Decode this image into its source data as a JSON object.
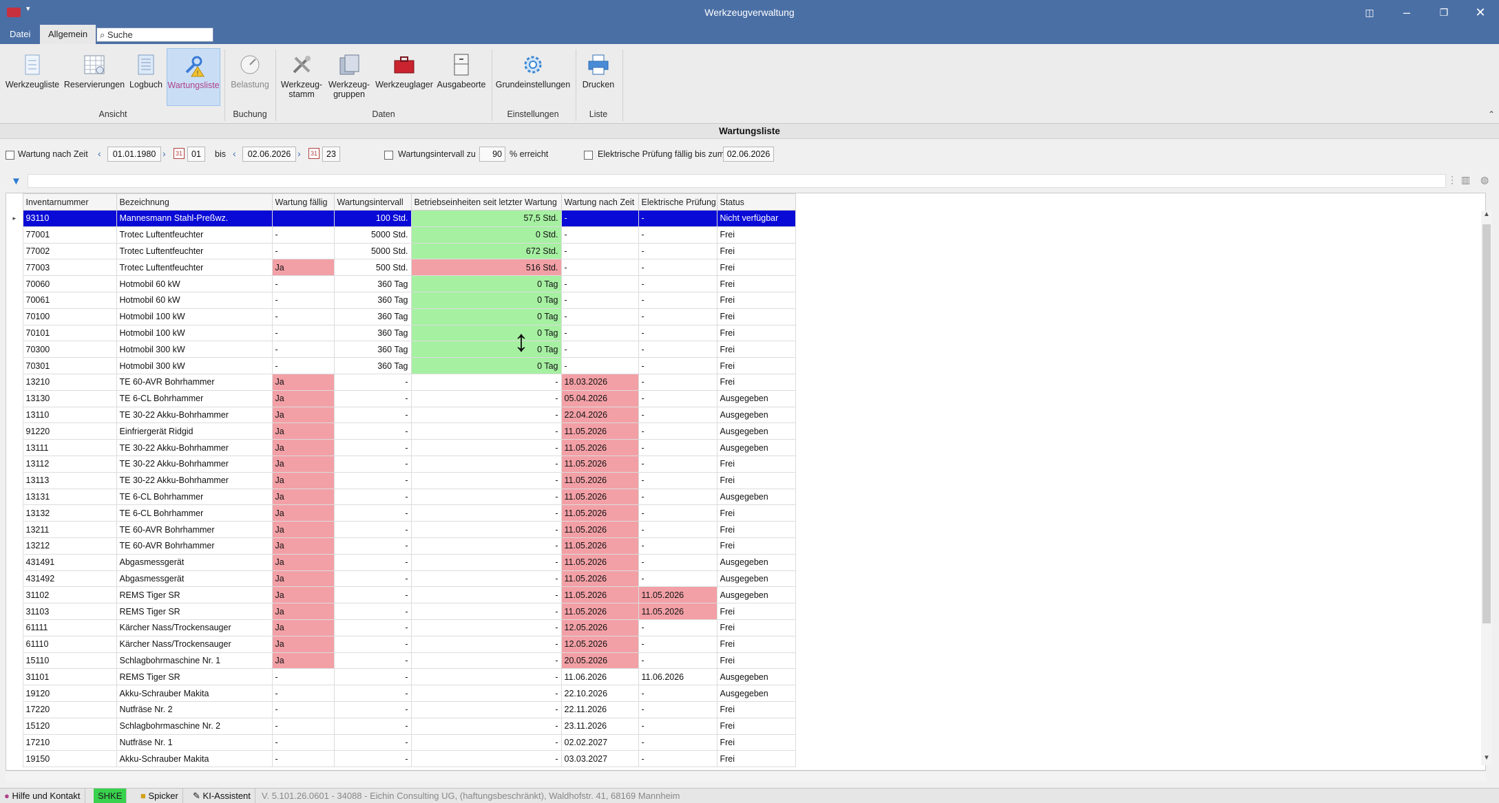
{
  "window": {
    "title": "Werkzeugverwaltung"
  },
  "menu": {
    "tab_datei": "Datei",
    "tab_allgemein": "Allgemein",
    "search_placeholder": "Suche"
  },
  "ribbon": {
    "buttons": [
      {
        "label": "Werkzeugliste"
      },
      {
        "label": "Reservierungen"
      },
      {
        "label": "Logbuch"
      },
      {
        "label": "Wartungsliste"
      },
      {
        "label": "Belastung"
      },
      {
        "label": "Werkzeug-\nstamm"
      },
      {
        "label": "Werkzeug-\ngruppen"
      },
      {
        "label": "Werkzeuglager"
      },
      {
        "label": "Ausgabeorte"
      },
      {
        "label": "Grundeinstellungen"
      },
      {
        "label": "Drucken"
      }
    ],
    "groups": [
      "Ansicht",
      "Buchung",
      "Daten",
      "Einstellungen",
      "Liste"
    ]
  },
  "section_title": "Wartungsliste",
  "filters": {
    "wartung_nach_zeit_label": "Wartung nach Zeit",
    "date_from": "01.01.1980",
    "day_from": "01",
    "bis_label": "bis",
    "date_to": "02.06.2026",
    "day_to": "23",
    "intervall_label": "Wartungsintervall zu",
    "intervall_value": "90",
    "intervall_suffix": "% erreicht",
    "elektrisch_label": "Elektrische Prüfung fällig bis zum",
    "elektrisch_date": "02.06.2026"
  },
  "table": {
    "columns": [
      "Inventarnummer",
      "Bezeichnung",
      "Wartung fällig",
      "Wartungsintervall",
      "Betriebseinheiten seit letzter Wartung",
      "Wartung nach Zeit",
      "Elektrische Prüfung",
      "Status"
    ],
    "rows": [
      [
        "93110",
        "Mannesmann Stahl-Preßwz.",
        "",
        "100 Std.",
        "57,5 Std.",
        "-",
        "-",
        "Nicht verfügbar"
      ],
      [
        "77001",
        "Trotec Luftentfeuchter",
        "-",
        "5000 Std.",
        "0 Std.",
        "-",
        "-",
        "Frei"
      ],
      [
        "77002",
        "Trotec Luftentfeuchter",
        "-",
        "5000 Std.",
        "672 Std.",
        "-",
        "-",
        "Frei"
      ],
      [
        "77003",
        "Trotec Luftentfeuchter",
        "Ja",
        "500 Std.",
        "516 Std.",
        "-",
        "-",
        "Frei"
      ],
      [
        "70060",
        "Hotmobil 60 kW",
        "-",
        "360 Tag",
        "0 Tag",
        "-",
        "-",
        "Frei"
      ],
      [
        "70061",
        "Hotmobil 60 kW",
        "-",
        "360 Tag",
        "0 Tag",
        "-",
        "-",
        "Frei"
      ],
      [
        "70100",
        "Hotmobil 100 kW",
        "-",
        "360 Tag",
        "0 Tag",
        "-",
        "-",
        "Frei"
      ],
      [
        "70101",
        "Hotmobil 100 kW",
        "-",
        "360 Tag",
        "0 Tag",
        "-",
        "-",
        "Frei"
      ],
      [
        "70300",
        "Hotmobil 300 kW",
        "-",
        "360 Tag",
        "0 Tag",
        "-",
        "-",
        "Frei"
      ],
      [
        "70301",
        "Hotmobil 300 kW",
        "-",
        "360 Tag",
        "0 Tag",
        "-",
        "-",
        "Frei"
      ],
      [
        "13210",
        "TE 60-AVR Bohrhammer",
        "Ja",
        "-",
        "-",
        "18.03.2026",
        "-",
        "Frei"
      ],
      [
        "13130",
        "TE 6-CL Bohrhammer",
        "Ja",
        "-",
        "-",
        "05.04.2026",
        "-",
        "Ausgegeben"
      ],
      [
        "13110",
        "TE 30-22 Akku-Bohrhammer",
        "Ja",
        "-",
        "-",
        "22.04.2026",
        "-",
        "Ausgegeben"
      ],
      [
        "91220",
        "Einfriergerät Ridgid",
        "Ja",
        "-",
        "-",
        "11.05.2026",
        "-",
        "Ausgegeben"
      ],
      [
        "13111",
        "TE 30-22 Akku-Bohrhammer",
        "Ja",
        "-",
        "-",
        "11.05.2026",
        "-",
        "Ausgegeben"
      ],
      [
        "13112",
        "TE 30-22 Akku-Bohrhammer",
        "Ja",
        "-",
        "-",
        "11.05.2026",
        "-",
        "Frei"
      ],
      [
        "13113",
        "TE 30-22 Akku-Bohrhammer",
        "Ja",
        "-",
        "-",
        "11.05.2026",
        "-",
        "Frei"
      ],
      [
        "13131",
        "TE 6-CL Bohrhammer",
        "Ja",
        "-",
        "-",
        "11.05.2026",
        "-",
        "Ausgegeben"
      ],
      [
        "13132",
        "TE 6-CL Bohrhammer",
        "Ja",
        "-",
        "-",
        "11.05.2026",
        "-",
        "Frei"
      ],
      [
        "13211",
        "TE 60-AVR Bohrhammer",
        "Ja",
        "-",
        "-",
        "11.05.2026",
        "-",
        "Frei"
      ],
      [
        "13212",
        "TE 60-AVR Bohrhammer",
        "Ja",
        "-",
        "-",
        "11.05.2026",
        "-",
        "Frei"
      ],
      [
        "431491",
        "Abgasmessgerät",
        "Ja",
        "-",
        "-",
        "11.05.2026",
        "-",
        "Ausgegeben"
      ],
      [
        "431492",
        "Abgasmessgerät",
        "Ja",
        "-",
        "-",
        "11.05.2026",
        "-",
        "Ausgegeben"
      ],
      [
        "31102",
        "REMS Tiger SR",
        "Ja",
        "-",
        "-",
        "11.05.2026",
        "11.05.2026",
        "Ausgegeben"
      ],
      [
        "31103",
        "REMS Tiger SR",
        "Ja",
        "-",
        "-",
        "11.05.2026",
        "11.05.2026",
        "Frei"
      ],
      [
        "61111",
        "Kärcher Nass/Trockensauger",
        "Ja",
        "-",
        "-",
        "12.05.2026",
        "-",
        "Frei"
      ],
      [
        "61110",
        "Kärcher Nass/Trockensauger",
        "Ja",
        "-",
        "-",
        "12.05.2026",
        "-",
        "Frei"
      ],
      [
        "15110",
        "Schlagbohrmaschine Nr. 1",
        "Ja",
        "-",
        "-",
        "20.05.2026",
        "-",
        "Frei"
      ],
      [
        "31101",
        "REMS Tiger SR",
        "-",
        "-",
        "-",
        "11.06.2026",
        "11.06.2026",
        "Ausgegeben"
      ],
      [
        "19120",
        "Akku-Schrauber Makita",
        "-",
        "-",
        "-",
        "22.10.2026",
        "-",
        "Ausgegeben"
      ],
      [
        "17220",
        "Nutfräse Nr. 2",
        "-",
        "-",
        "-",
        "22.11.2026",
        "-",
        "Frei"
      ],
      [
        "15120",
        "Schlagbohrmaschine Nr. 2",
        "-",
        "-",
        "-",
        "23.11.2026",
        "-",
        "Frei"
      ],
      [
        "17210",
        "Nutfräse Nr. 1",
        "-",
        "-",
        "-",
        "02.02.2027",
        "-",
        "Frei"
      ],
      [
        "19150",
        "Akku-Schrauber Makita",
        "-",
        "-",
        "-",
        "03.03.2027",
        "-",
        "Frei"
      ]
    ]
  },
  "statusbar": {
    "help": "Hilfe und Kontakt",
    "shke": "SHKE",
    "spicker": "Spicker",
    "ki": "KI-Assistent",
    "version": "V. 5.101.26.0601 - 34088 - Eichin Consulting UG, (haftungsbeschränkt), Waldhofstr. 41, 68169 Mannheim"
  },
  "colors": {
    "titlebar": "#4a6fa5",
    "selected_row": "#0a0ad6",
    "due_red": "#f2a0a6",
    "ok_green": "#a6f0a2",
    "shke_green": "#39d14d"
  },
  "icons": [
    "app-icon",
    "search-icon",
    "filter-icon",
    "restore-icon",
    "minimize-icon",
    "maximize-icon",
    "close-icon"
  ]
}
